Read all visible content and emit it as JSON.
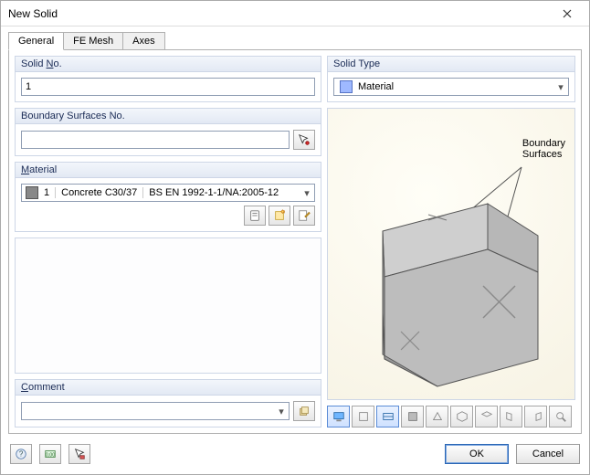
{
  "window": {
    "title": "New Solid"
  },
  "tabs": [
    {
      "label": "General",
      "active": true
    },
    {
      "label": "FE Mesh",
      "active": false
    },
    {
      "label": "Axes",
      "active": false
    }
  ],
  "left": {
    "solid_no": {
      "header_pre": "Solid ",
      "header_u": "N",
      "header_post": "o.",
      "value": "1"
    },
    "boundary": {
      "header": "Boundary Surfaces No.",
      "value": "",
      "pick_icon": "pick"
    },
    "material": {
      "header_u": "M",
      "header_post": "aterial",
      "index": "1",
      "name": "Concrete C30/37",
      "code": "BS EN 1992-1-1/NA:2005-12",
      "buttons": [
        "library",
        "new",
        "edit"
      ]
    },
    "comment": {
      "header_u": "C",
      "header_post": "omment",
      "value": ""
    }
  },
  "right": {
    "solid_type": {
      "header": "Solid Type",
      "value": "Material"
    },
    "preview": {
      "boundary_label": "Boundary\nSurfaces"
    },
    "view_buttons": [
      "views",
      "wire",
      "frame",
      "solid",
      "persp",
      "iso",
      "xy",
      "xz",
      "yz",
      "fit"
    ]
  },
  "footer": {
    "help_icon": "help",
    "units_icon": "units",
    "pick_icon": "pick-color",
    "ok": "OK",
    "cancel": "Cancel"
  }
}
